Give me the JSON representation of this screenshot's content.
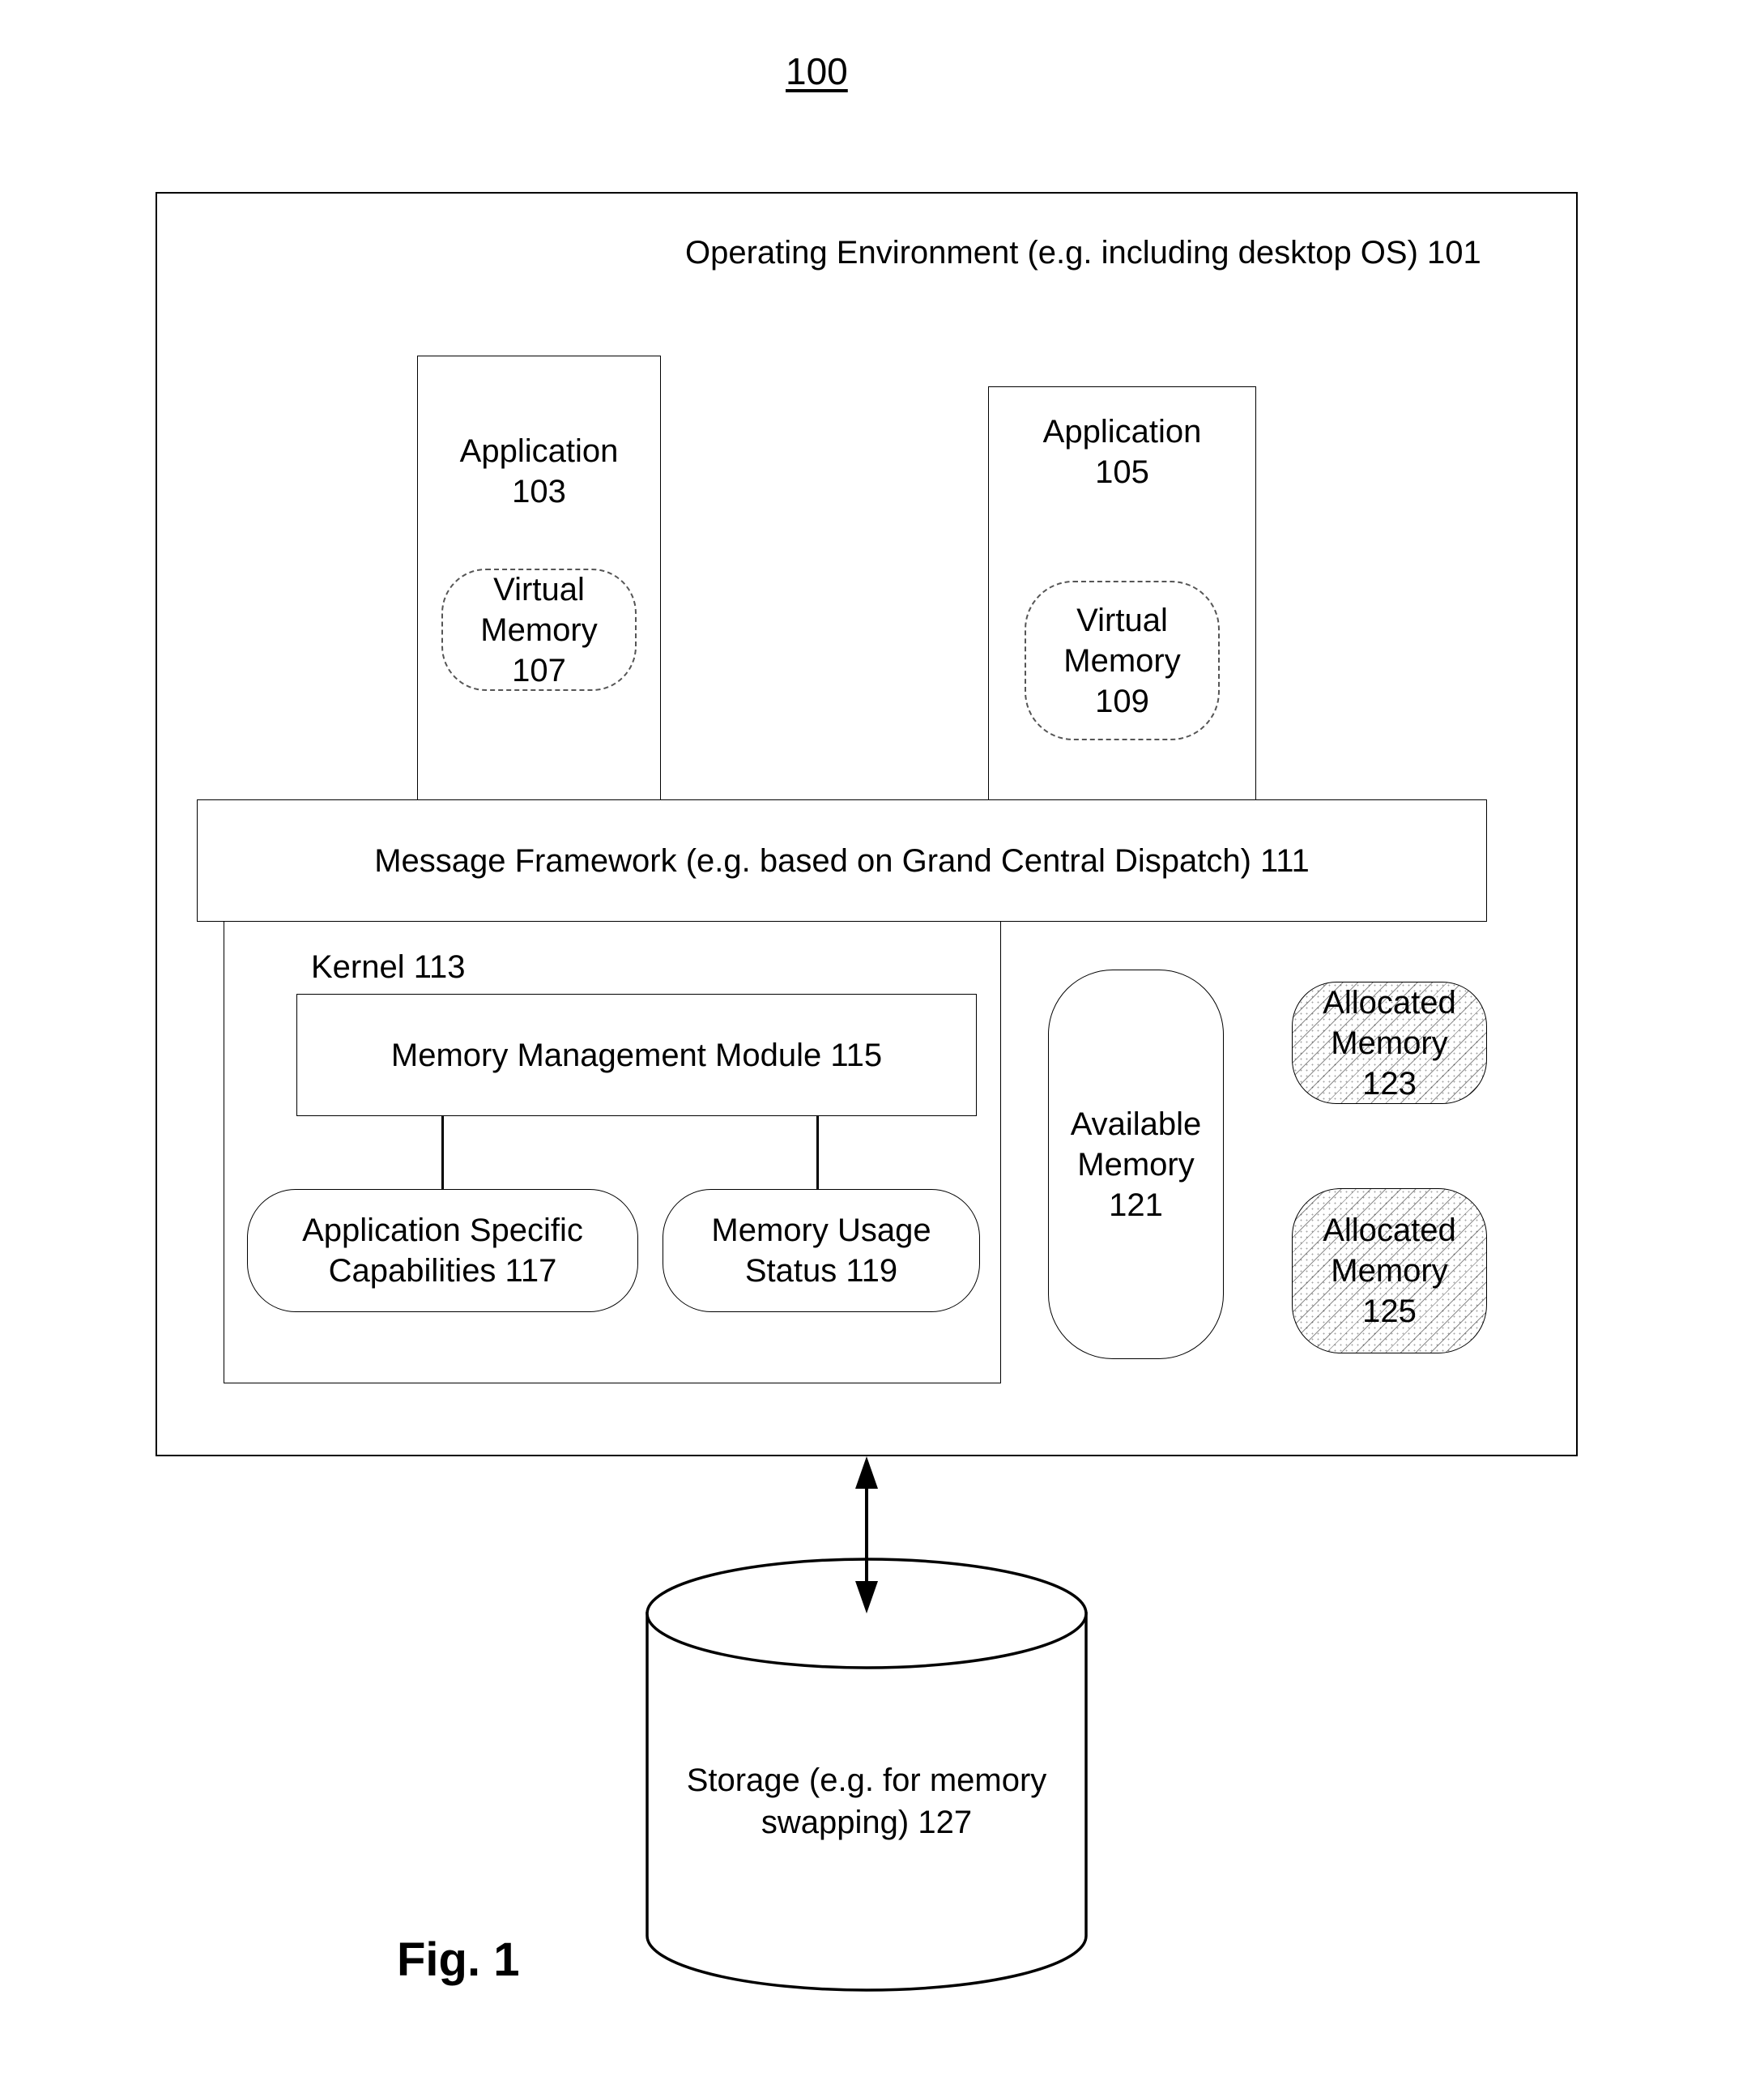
{
  "figure": {
    "reference_number": "100",
    "caption": "Fig. 1"
  },
  "operating_environment": {
    "label": "Operating Environment (e.g. including desktop OS) 101"
  },
  "applications": [
    {
      "title": "Application",
      "number": "103",
      "virtual_memory": {
        "line1": "Virtual",
        "line2": "Memory",
        "number": "107"
      }
    },
    {
      "title": "Application",
      "number": "105",
      "virtual_memory": {
        "line1": "Virtual",
        "line2": "Memory",
        "number": "109"
      }
    }
  ],
  "message_framework": {
    "label": "Message Framework (e.g. based on Grand Central Dispatch) 111"
  },
  "kernel": {
    "label": "Kernel 113",
    "memory_management_module": {
      "label": "Memory Management Module 115"
    },
    "application_specific_capabilities": {
      "line1": "Application Specific",
      "line2": "Capabilities 117"
    },
    "memory_usage_status": {
      "line1": "Memory Usage",
      "line2": "Status 119"
    }
  },
  "memory": {
    "available": {
      "line1": "Available",
      "line2": "Memory",
      "number": "121"
    },
    "allocated": [
      {
        "line1": "Allocated",
        "line2": "Memory",
        "number": "123"
      },
      {
        "line1": "Allocated",
        "line2": "Memory",
        "number": "125"
      }
    ]
  },
  "storage": {
    "line1": "Storage (e.g. for memory",
    "line2": "swapping) 127"
  },
  "connections": [
    {
      "from": "Memory Management Module 115",
      "to": "Application Specific Capabilities 117",
      "type": "line"
    },
    {
      "from": "Memory Management Module 115",
      "to": "Memory Usage Status 119",
      "type": "line"
    },
    {
      "from": "Operating Environment 101",
      "to": "Storage 127",
      "type": "bidirectional-arrow"
    }
  ]
}
